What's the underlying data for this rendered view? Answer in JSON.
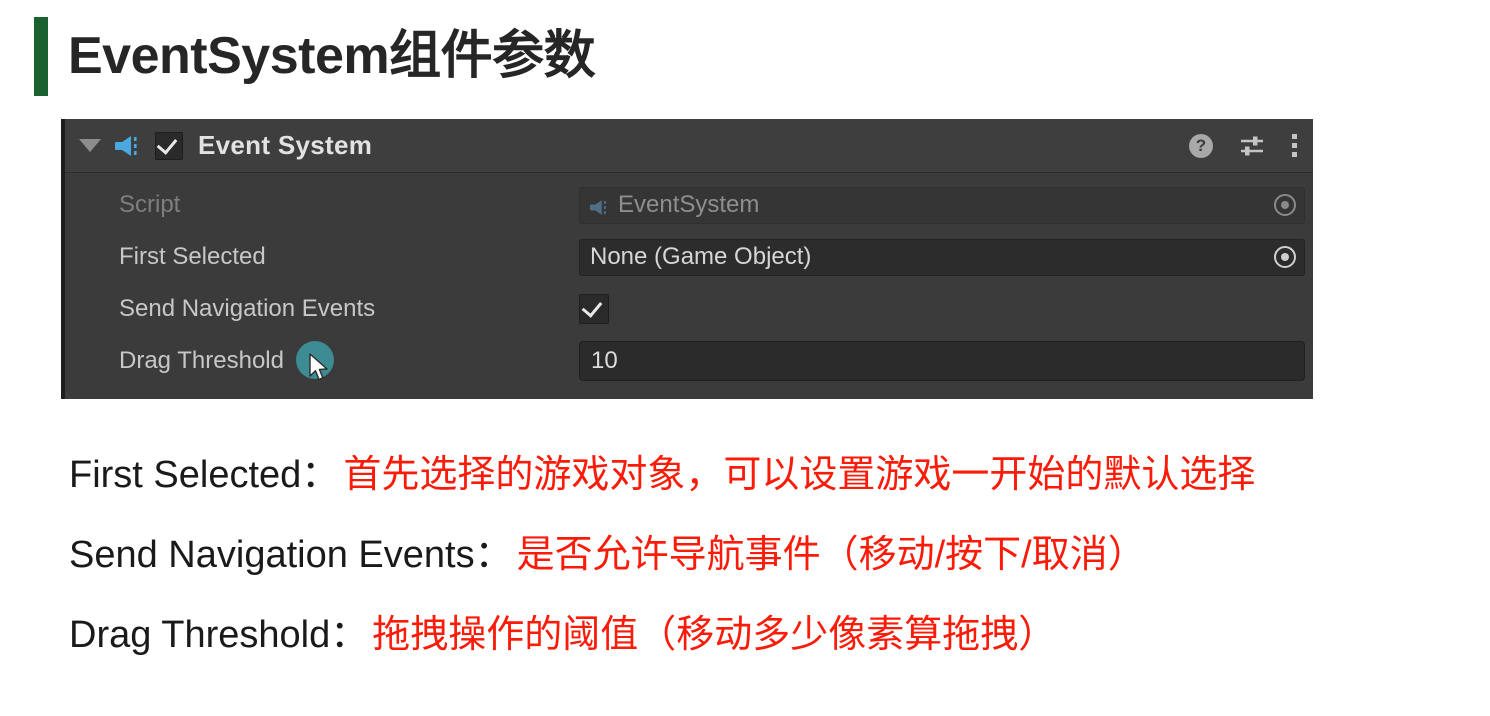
{
  "page": {
    "title": "EventSystem组件参数",
    "accent_color": "#1a6130"
  },
  "inspector": {
    "component_header": {
      "foldout_icon": "triangle-down-icon",
      "component_icon": "event-system-megaphone-icon",
      "enabled_checkbox": true,
      "title": "Event System",
      "help_icon_label": "?",
      "preset_icon": "preset-sliders-icon",
      "more_menu_icon": "kebab-menu-icon"
    },
    "properties": [
      {
        "label": "Script",
        "disabled": true,
        "field_type": "object",
        "value": "EventSystem",
        "has_icon": true,
        "picker_icon": "object-picker-icon"
      },
      {
        "label": "First Selected",
        "disabled": false,
        "field_type": "object",
        "value": "None (Game Object)",
        "has_icon": false,
        "picker_icon": "object-picker-icon"
      },
      {
        "label": "Send Navigation Events",
        "disabled": false,
        "field_type": "checkbox",
        "value": true
      },
      {
        "label": "Drag Threshold",
        "disabled": false,
        "field_type": "number",
        "value": "10",
        "cursor_highlight": true,
        "cursor_highlight_color": "#3d8b93"
      }
    ]
  },
  "captions": [
    {
      "term": "First Selected：",
      "description": "首先选择的游戏对象，可以设置游戏一开始的默认选择"
    },
    {
      "term": "Send Navigation Events：",
      "description": "是否允许导航事件（移动/按下/取消）"
    },
    {
      "term": "Drag Threshold：",
      "description": "拖拽操作的阈值（移动多少像素算拖拽）"
    }
  ]
}
